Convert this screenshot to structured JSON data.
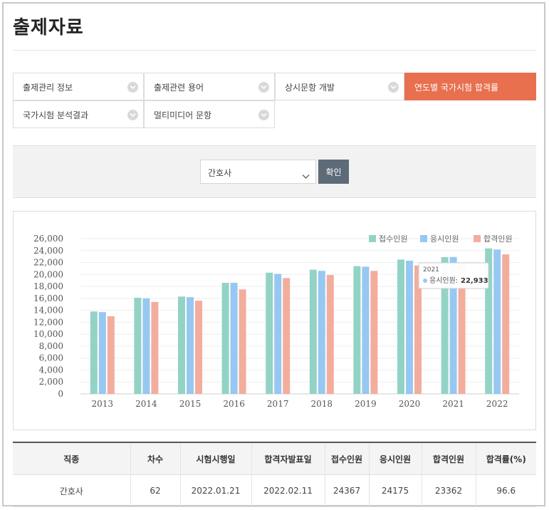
{
  "page": {
    "title": "출제자료"
  },
  "menu": {
    "items": [
      {
        "label": "출제관리 정보",
        "active": false
      },
      {
        "label": "출제관련 용어",
        "active": false
      },
      {
        "label": "상시문항 개발",
        "active": false
      },
      {
        "label": "연도별 국가시험 합격률",
        "active": true
      },
      {
        "label": "국가시험 분석결과",
        "active": false
      },
      {
        "label": "멀티미디어 문항",
        "active": false
      }
    ]
  },
  "search": {
    "selected_job": "간호사",
    "confirm_label": "확인"
  },
  "colors": {
    "accent": "#e8704f",
    "button": "#5d6b78"
  },
  "chart_data": {
    "type": "bar",
    "categories": [
      "2013",
      "2014",
      "2015",
      "2016",
      "2017",
      "2018",
      "2019",
      "2020",
      "2021",
      "2022"
    ],
    "series": [
      {
        "name": "접수인원",
        "color": "#93d3c6",
        "values": [
          13800,
          16100,
          16300,
          18600,
          20300,
          20800,
          21400,
          22500,
          22900,
          24367
        ]
      },
      {
        "name": "응시인원",
        "color": "#97c8f2",
        "values": [
          13700,
          16000,
          16200,
          18600,
          20100,
          20600,
          21300,
          22300,
          22933,
          24175
        ]
      },
      {
        "name": "합격인원",
        "color": "#f3ad9d",
        "values": [
          13000,
          15400,
          15600,
          17500,
          19400,
          19900,
          20600,
          21500,
          21700,
          23362
        ]
      }
    ],
    "ylim": [
      0,
      26000
    ],
    "yticks": [
      "0",
      "2,000",
      "4,000",
      "6,000",
      "8,000",
      "10,000",
      "12,000",
      "14,000",
      "16,000",
      "18,000",
      "20,000",
      "22,000",
      "24,000",
      "26,000"
    ],
    "grid": true,
    "legend": "top-right",
    "tooltip": {
      "title": "2021",
      "series": "응시인원",
      "value": "22,933",
      "category_index": 8,
      "series_index": 1
    }
  },
  "table": {
    "headers": [
      "직종",
      "차수",
      "시험시행일",
      "합격자발표일",
      "접수인원",
      "응시인원",
      "합격인원",
      "합격률(%)"
    ],
    "rows": [
      [
        "간호사",
        "62",
        "2022.01.21",
        "2022.02.11",
        "24367",
        "24175",
        "23362",
        "96.6"
      ]
    ]
  }
}
